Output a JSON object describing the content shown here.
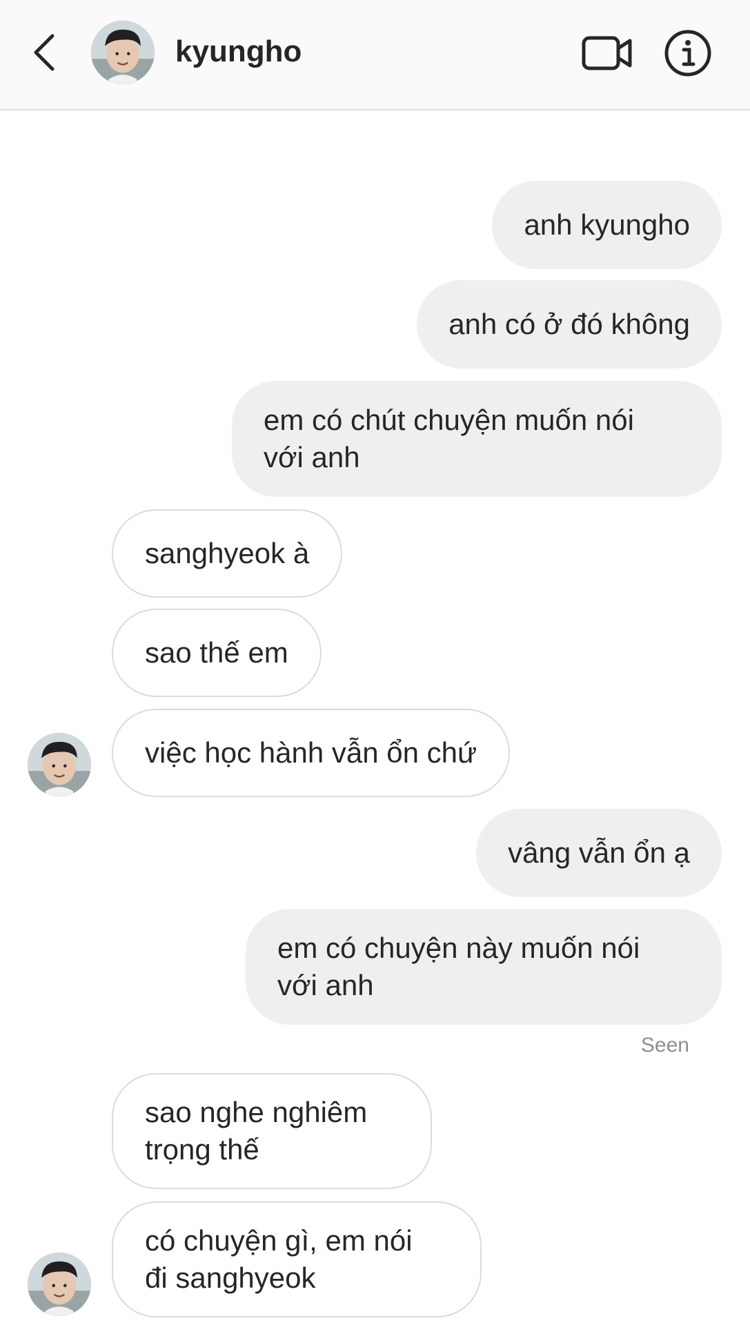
{
  "header": {
    "contact_name": "kyungho",
    "back_icon": "chevron-left-icon",
    "video_icon": "video-camera-icon",
    "info_icon": "info-icon"
  },
  "messages": [
    {
      "direction": "sent",
      "text": "anh kyungho"
    },
    {
      "direction": "sent",
      "text": "anh có ở đó không"
    },
    {
      "direction": "sent",
      "lines": [
        "em có chút chuyện muốn nói",
        "với anh"
      ]
    },
    {
      "direction": "received",
      "text": "sanghyeok à"
    },
    {
      "direction": "received",
      "text": "sao thế em"
    },
    {
      "direction": "received",
      "text": "việc học hành vẫn ổn chứ"
    },
    {
      "direction": "sent",
      "text": "vâng vẫn ổn ạ"
    },
    {
      "direction": "sent",
      "lines": [
        "em có chuyện này muốn nói",
        "với anh"
      ]
    },
    {
      "direction": "received",
      "lines": [
        "sao nghe nghiêm",
        "trọng thế"
      ]
    },
    {
      "direction": "received",
      "lines": [
        "có chuyện gì, em nói",
        "đi sanghyeok"
      ]
    }
  ],
  "status": {
    "seen": "Seen"
  },
  "colors": {
    "sent_bubble": "#efefef",
    "received_border": "#dbdbdb",
    "text": "#262626",
    "meta": "#8e8e8e"
  }
}
